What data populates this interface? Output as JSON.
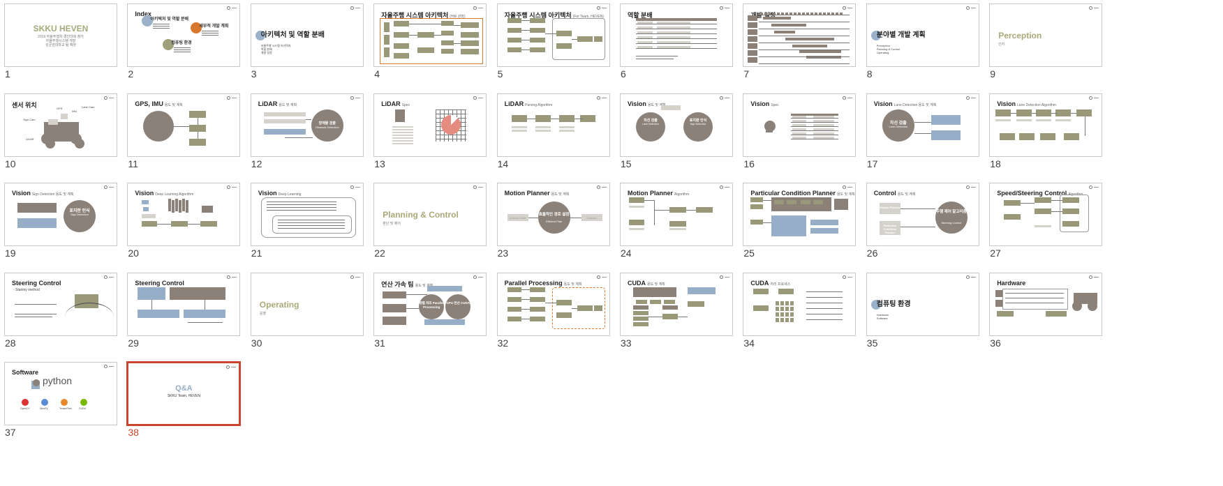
{
  "colors": {
    "selected": "#c9452e",
    "olive": "#99997a",
    "blue": "#97aec8",
    "brown": "#8b8179"
  },
  "slides": [
    {
      "n": "1",
      "kind": "cover",
      "title": "SKKU HEVEN",
      "lines": [
        "2019 자율주행차 경진대회 참가",
        "자율주행시스템 개발",
        "성균관대학교 팀 헤븐"
      ]
    },
    {
      "n": "2",
      "kind": "index",
      "title": "Index",
      "items": [
        "아키텍처 및 역할 분배",
        "세부적 개발 계획",
        "컴퓨팅 환경"
      ]
    },
    {
      "n": "3",
      "kind": "section",
      "title": "아키텍처 및 역할 분배",
      "lines": [
        "자율주행 시스템 아키텍처",
        "역할 분배",
        "개발 일정"
      ]
    },
    {
      "n": "4",
      "kind": "arch",
      "title": "자율주행 시스템 아키텍처",
      "sub": "(HW 관점)"
    },
    {
      "n": "5",
      "kind": "arch2",
      "title": "자율주행 시스템 아키텍처",
      "sub": "(For Team, HEVEN)"
    },
    {
      "n": "6",
      "kind": "table",
      "title": "역할 분배"
    },
    {
      "n": "7",
      "kind": "gantt",
      "title": "개발 일정"
    },
    {
      "n": "8",
      "kind": "section",
      "title": "분야별 개발 계획",
      "lines": [
        "Perception",
        "Planning & Control",
        "Operating"
      ]
    },
    {
      "n": "9",
      "kind": "plain",
      "title": "Perception",
      "lines": [
        "인지"
      ]
    },
    {
      "n": "10",
      "kind": "car",
      "title": "센서 위치",
      "labels": [
        "Lane Cam",
        "Sign Cam",
        "LiDAR",
        "GPS",
        "IMU"
      ]
    },
    {
      "n": "11",
      "kind": "gps",
      "title": "GPS, IMU",
      "sub": "용도 및 계획"
    },
    {
      "n": "12",
      "kind": "lidar",
      "title": "LiDAR",
      "sub": "용도 및 계획",
      "circle": "장애물 검출",
      "circle_en": "Obstacle Detection"
    },
    {
      "n": "13",
      "kind": "lidarspec",
      "title": "LiDAR",
      "sub": "Spec"
    },
    {
      "n": "14",
      "kind": "flow",
      "title": "LiDAR",
      "sub": "Parsing Algorithm"
    },
    {
      "n": "15",
      "kind": "vision2",
      "title": "Vision",
      "sub": "용도 및 계획",
      "c1": "차선 검출",
      "c1e": "Lane Detection",
      "c2": "표지판 인식",
      "c2e": "Sign Detection"
    },
    {
      "n": "16",
      "kind": "spec",
      "title": "Vision",
      "sub": "Spec"
    },
    {
      "n": "17",
      "kind": "vision1",
      "title": "Vision",
      "sub": "Lane Detection 용도 및 계획",
      "c1": "차선 검출",
      "c1e": "Lane Detection"
    },
    {
      "n": "18",
      "kind": "flow",
      "title": "Vision",
      "sub": "Lane Detection Algorithm"
    },
    {
      "n": "19",
      "kind": "sign",
      "title": "Vision",
      "sub": "Sign Detection 용도 및 계획",
      "c1": "표지판 인식",
      "c1e": "Sign Detection"
    },
    {
      "n": "20",
      "kind": "dl",
      "title": "Vision",
      "sub": "Deep Learning Algorithm"
    },
    {
      "n": "21",
      "kind": "dl2",
      "title": "Vision",
      "sub": "Deep Learning"
    },
    {
      "n": "22",
      "kind": "plain",
      "title": "Planning & Control",
      "lines": [
        "판단 및 제어"
      ]
    },
    {
      "n": "23",
      "kind": "mp",
      "title": "Motion Planner",
      "sub": "용도 및 계획",
      "c1": "효율적인 경로 설정",
      "c1e": "Efficient Plan",
      "left": "Sensor Data",
      "right": "Control"
    },
    {
      "n": "24",
      "kind": "flow",
      "title": "Motion Planner",
      "sub": "Algorithm"
    },
    {
      "n": "25",
      "kind": "pcp",
      "title": "Particular Condition Planner",
      "sub": "용도 및 계획"
    },
    {
      "n": "26",
      "kind": "ctrl",
      "title": "Control",
      "sub": "용도 및 계획",
      "c1": "주행 제어 알고리즘",
      "c1e": "Steering Control",
      "left1": "Motion Planner",
      "left2": "Particular Condition Planner"
    },
    {
      "n": "27",
      "kind": "flow",
      "title": "Speed/Steering Control",
      "sub": "Algorithm"
    },
    {
      "n": "28",
      "kind": "stanley",
      "title": "Steering Control",
      "bullet": "- Stanley method"
    },
    {
      "n": "29",
      "kind": "sc2",
      "title": "Steering Control"
    },
    {
      "n": "30",
      "kind": "plain",
      "title": "Operating",
      "lines": [
        "운영"
      ]
    },
    {
      "n": "31",
      "kind": "speed",
      "title": "연산 가속 팀",
      "sub": "용도 및 계획",
      "c1": "병렬 처리 Parallel Processing",
      "c2": "GPU 연산 CUDA"
    },
    {
      "n": "32",
      "kind": "arch2",
      "title": "Parallel Processing",
      "sub": "용도 및 계획"
    },
    {
      "n": "33",
      "kind": "cuda",
      "title": "CUDA",
      "sub": "용도 및 계획"
    },
    {
      "n": "34",
      "kind": "cuda2",
      "title": "CUDA",
      "sub": "처리 프로세스"
    },
    {
      "n": "35",
      "kind": "section",
      "title": "컴퓨팅 환경",
      "lines": [
        "Hardware",
        "Software"
      ]
    },
    {
      "n": "36",
      "kind": "hw",
      "title": "Hardware"
    },
    {
      "n": "37",
      "kind": "sw",
      "title": "Software",
      "python": "python",
      "logos": [
        "OpenCV",
        "NumPy",
        "TensorFlow",
        "CUDA"
      ]
    },
    {
      "n": "38",
      "kind": "qa",
      "title": "Q&A",
      "lines": [
        "SKKU Team, HEVEN"
      ],
      "selected": true
    }
  ]
}
